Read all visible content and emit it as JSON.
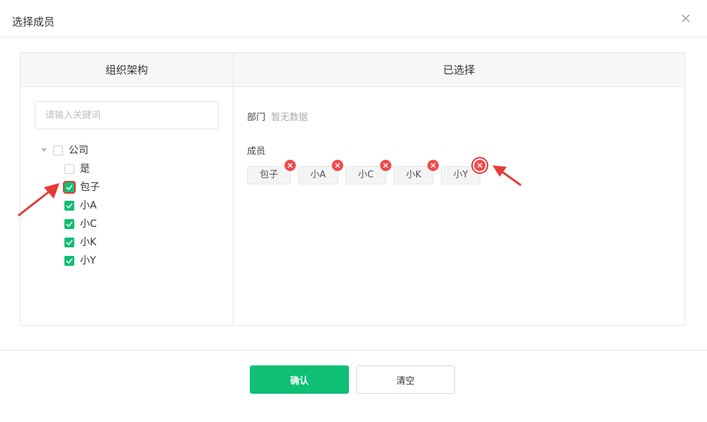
{
  "dialog": {
    "title": "选择成员",
    "close_icon": "close-icon"
  },
  "left": {
    "header": "组织架构",
    "search_placeholder": "请输入关键词",
    "root": {
      "label": "公司",
      "checked": false,
      "icon": "caret-down-icon"
    },
    "items": [
      {
        "label": "是",
        "checked": false
      },
      {
        "label": "包子",
        "checked": true
      },
      {
        "label": "小A",
        "checked": true
      },
      {
        "label": "小C",
        "checked": true
      },
      {
        "label": "小K",
        "checked": true
      },
      {
        "label": "小Y",
        "checked": true
      }
    ]
  },
  "right": {
    "header": "已选择",
    "dept_label": "部门",
    "dept_empty": "暂无数据",
    "member_label": "成员",
    "tags": [
      {
        "label": "包子",
        "remove_icon": "remove-icon"
      },
      {
        "label": "小A",
        "remove_icon": "remove-icon"
      },
      {
        "label": "小C",
        "remove_icon": "remove-icon"
      },
      {
        "label": "小K",
        "remove_icon": "remove-icon"
      },
      {
        "label": "小Y",
        "remove_icon": "remove-icon"
      }
    ]
  },
  "footer": {
    "confirm_label": "确认",
    "clear_label": "清空"
  },
  "colors": {
    "accent": "#0fbf73",
    "remove": "#ef4b4b",
    "annotation": "#e53935"
  }
}
